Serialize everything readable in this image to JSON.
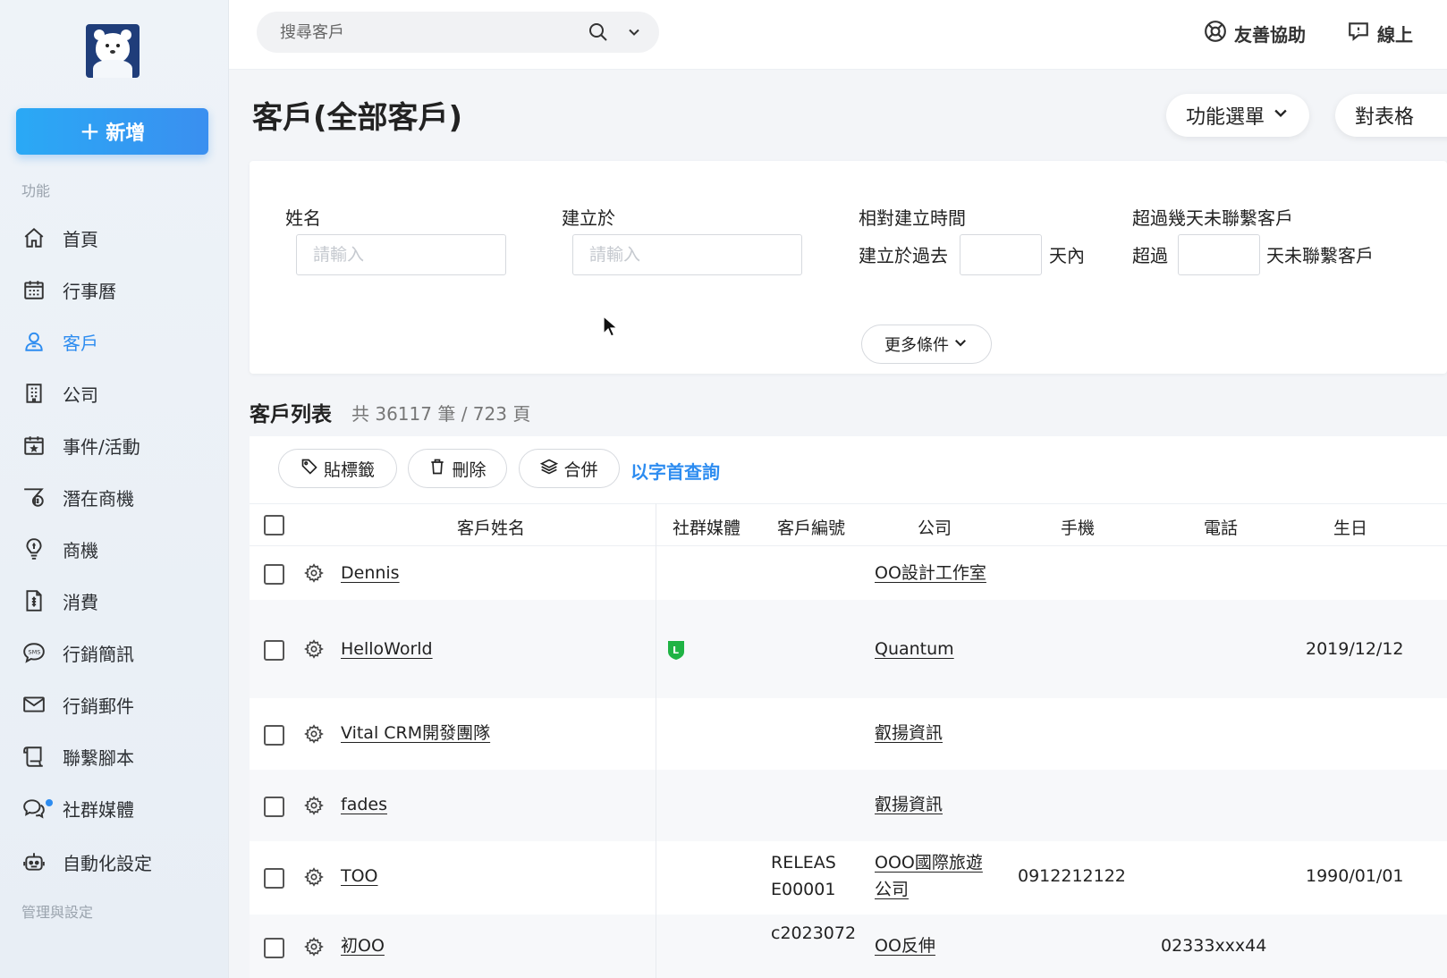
{
  "sidebar": {
    "new_button_label": "新增",
    "section_features": "功能",
    "section_admin": "管理與設定",
    "items": [
      {
        "label": "首頁",
        "icon": "home-icon"
      },
      {
        "label": "行事曆",
        "icon": "calendar-icon"
      },
      {
        "label": "客戶",
        "icon": "customer-icon",
        "active": true
      },
      {
        "label": "公司",
        "icon": "building-icon"
      },
      {
        "label": "事件/活動",
        "icon": "event-icon"
      },
      {
        "label": "潛在商機",
        "icon": "lead-icon"
      },
      {
        "label": "商機",
        "icon": "opportunity-icon"
      },
      {
        "label": "消費",
        "icon": "invoice-icon"
      },
      {
        "label": "行銷簡訊",
        "icon": "sms-icon"
      },
      {
        "label": "行銷郵件",
        "icon": "mail-icon"
      },
      {
        "label": "聯繫腳本",
        "icon": "script-icon"
      },
      {
        "label": "社群媒體",
        "icon": "social-icon"
      },
      {
        "label": "自動化設定",
        "icon": "robot-icon"
      }
    ]
  },
  "topbar": {
    "search_placeholder": "搜尋客戶",
    "help_label": "友善協助",
    "online_label": "線上"
  },
  "page": {
    "title": "客戶(全部客戶)",
    "function_menu_label": "功能選單",
    "report_label": "對表格"
  },
  "filters": {
    "name_label": "姓名",
    "name_placeholder": "請輸入",
    "created_label": "建立於",
    "created_placeholder": "請輸入",
    "relative_label": "相對建立時間",
    "relative_prefix": "建立於過去",
    "relative_suffix": "天內",
    "nocontact_label": "超過幾天未聯繫客戶",
    "nocontact_prefix": "超過",
    "nocontact_suffix": "天未聯繫客戶",
    "more_label": "更多條件"
  },
  "list": {
    "title": "客戶列表",
    "count": "共 36117 筆 / 723 頁",
    "actions": {
      "tag": "貼標籤",
      "delete": "刪除",
      "merge": "合併",
      "alpha": "以字首查詢"
    },
    "columns": [
      "客戶姓名",
      "社群媒體",
      "客戶編號",
      "公司",
      "手機",
      "電話",
      "生日"
    ],
    "rows": [
      {
        "name": "Dennis",
        "social": "",
        "code": "",
        "company": "OO設計工作室",
        "mobile": "",
        "phone": "",
        "birthday": ""
      },
      {
        "name": "HelloWorld",
        "social": "line",
        "code": "",
        "company": "Quantum",
        "mobile": "",
        "phone": "",
        "birthday": "2019/12/12"
      },
      {
        "name": "Vital CRM開發團隊",
        "social": "",
        "code": "",
        "company": "叡揚資訊",
        "mobile": "",
        "phone": "",
        "birthday": ""
      },
      {
        "name": "fades",
        "social": "",
        "code": "",
        "company": "叡揚資訊",
        "mobile": "",
        "phone": "",
        "birthday": ""
      },
      {
        "name": "TOO",
        "social": "",
        "code_line1": "RELEAS",
        "code_line2": "E00001",
        "company_line1": "OOO國際旅遊",
        "company_line2": "公司",
        "mobile": "0912212122",
        "phone": "",
        "birthday": "1990/01/01"
      },
      {
        "name": "初OO",
        "social": "",
        "code": "c2023072",
        "company": "OO反伸",
        "mobile": "",
        "phone": "02333xxx44",
        "birthday": ""
      }
    ]
  },
  "colors": {
    "accent": "#2d8cf0",
    "line_green": "#1fb344"
  }
}
